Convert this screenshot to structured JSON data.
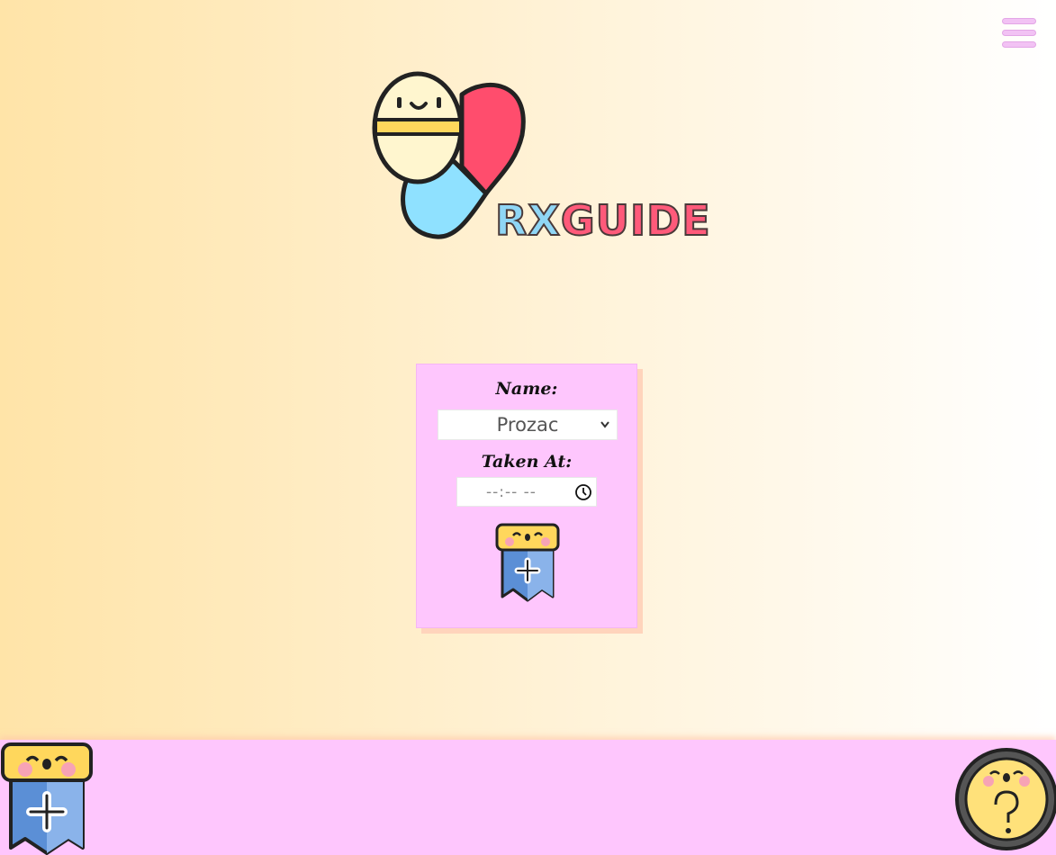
{
  "menu": {
    "icon": "hamburger-menu-icon"
  },
  "logo": {
    "rx": "RX",
    "guide": "GUIDE",
    "icon": "pill-heart-mascot-icon"
  },
  "form": {
    "name_label": "Name:",
    "medication_value": "Prozac",
    "time_label": "Taken At:",
    "time_placeholder": "--:-- --",
    "add_icon": "add-medication-mascot-icon"
  },
  "footer": {
    "add_icon": "add-mascot-icon",
    "help_icon": "help-question-mascot-icon"
  },
  "colors": {
    "card": "#fec6fd",
    "footer": "#fec6fd",
    "accent_pink": "#ff5a7a",
    "accent_blue": "#8fd6f5",
    "yellow": "#ffe17a"
  }
}
